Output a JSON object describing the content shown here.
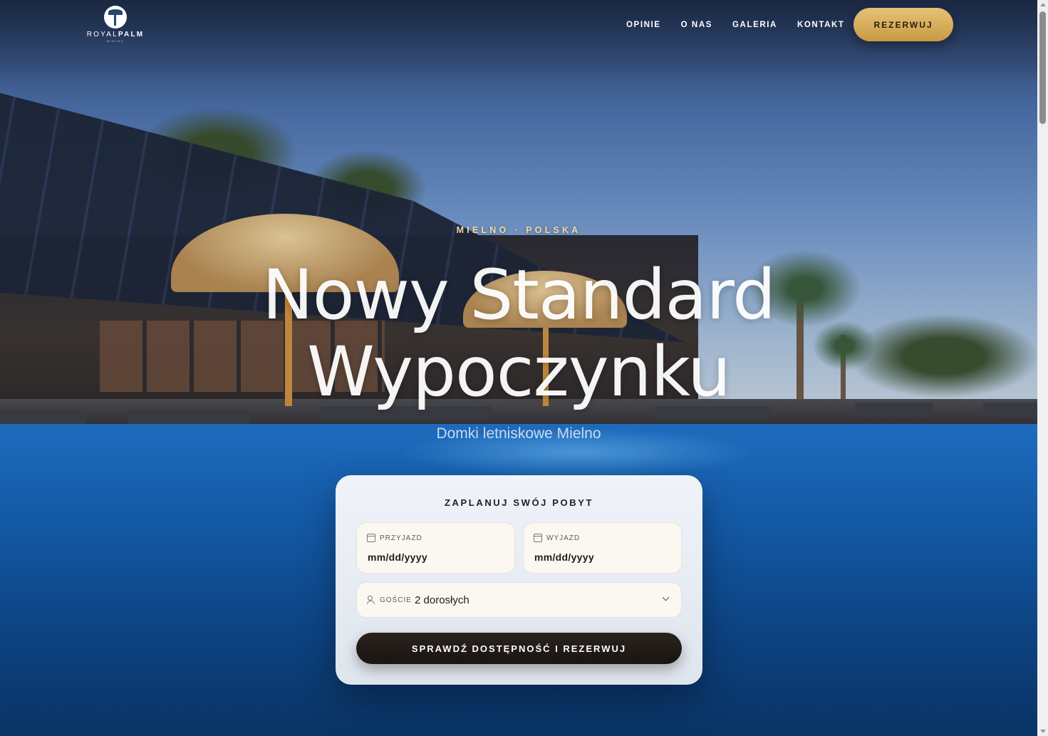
{
  "brand": {
    "name_light": "ROYAL",
    "name_bold": "PALM",
    "sub": "MIELNO"
  },
  "nav": {
    "items": [
      {
        "label": "OPINIE"
      },
      {
        "label": "O NAS"
      },
      {
        "label": "GALERIA"
      },
      {
        "label": "KONTAKT"
      }
    ],
    "cta_label": "REZERWUJ"
  },
  "hero": {
    "eyebrow": "MIELNO · POLSKA",
    "headline_line1": "Nowy Standard",
    "headline_line2": "Wypoczynku",
    "subline": "Domki letniskowe Mielno"
  },
  "booking": {
    "title": "ZAPLANUJ SWÓJ POBYT",
    "checkin": {
      "label": "PRZYJAZD",
      "placeholder": "mm/dd/yyyy"
    },
    "checkout": {
      "label": "WYJAZD",
      "placeholder": "mm/dd/yyyy"
    },
    "guests": {
      "label": "GOŚCIE",
      "value": "2 dorosłych"
    },
    "submit_label": "SPRAWDŹ DOSTĘPNOŚĆ I REZERWUJ"
  },
  "colors": {
    "accent_gold": "#d7ad5c",
    "button_dark": "#221b17",
    "card_bg": "#f1f3f7"
  },
  "icons": {
    "calendar": "calendar-icon",
    "users": "users-icon",
    "chevron": "chevron-down-icon"
  }
}
